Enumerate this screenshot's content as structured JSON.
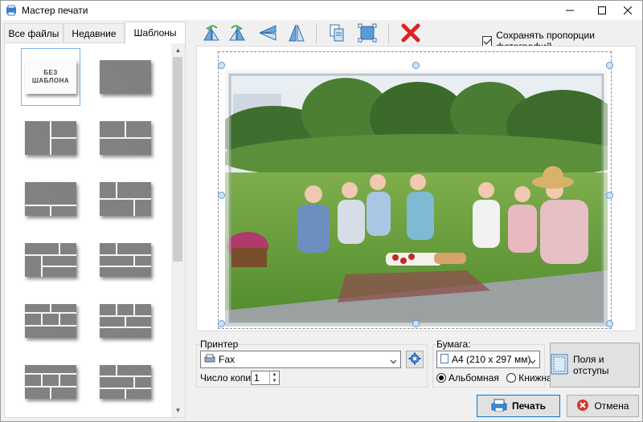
{
  "window": {
    "title": "Мастер печати",
    "controls": [
      "minimize-icon",
      "maximize-icon",
      "close-icon"
    ]
  },
  "tabs": [
    {
      "label": "Все файлы",
      "active": false
    },
    {
      "label": "Недавние",
      "active": false
    },
    {
      "label": "Шаблоны",
      "active": true
    }
  ],
  "templates": {
    "no_template_label": "БЕЗ ШАБЛОНА",
    "count": 12,
    "selected_index": 0
  },
  "toolbar": {
    "buttons": [
      "rotate-left-icon",
      "rotate-right-icon",
      "flip-horizontal-icon",
      "flip-vertical-icon",
      "copy-icon",
      "fit-frame-icon",
      "delete-icon"
    ],
    "keep_ratio_label": "Сохранять пропорции фотографий",
    "keep_ratio_checked": true
  },
  "printer": {
    "group_label": "Принтер",
    "selected": "Fax",
    "copies_label": "Число копий:",
    "copies_value": "1"
  },
  "paper": {
    "group_label": "Бумага:",
    "selected": "A4 (210 x 297 мм)",
    "orientation_landscape": "Альбомная",
    "orientation_portrait": "Книжная",
    "selected_orientation": "landscape"
  },
  "buttons": {
    "margins": "Поля и отступы",
    "print": "Печать",
    "cancel": "Отмена"
  },
  "colors": {
    "accent": "#0078d7",
    "selection": "#7ab5ea",
    "delete": "#e02020"
  }
}
